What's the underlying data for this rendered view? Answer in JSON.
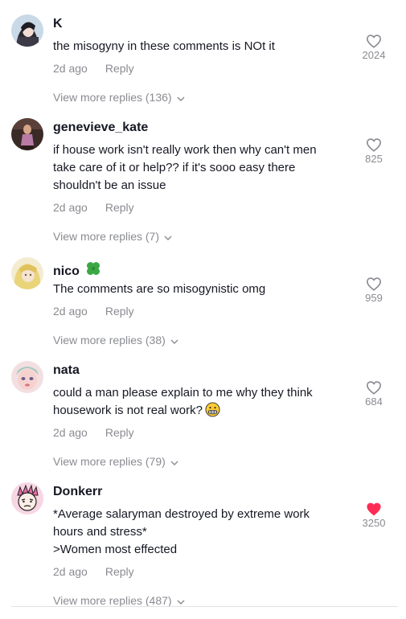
{
  "comments": [
    {
      "username": "K",
      "text": "the misogyny in these comments is NOt it",
      "time": "2d ago",
      "reply_label": "Reply",
      "likes": "2024",
      "liked": false,
      "view_replies": "View more replies (136)",
      "avatar_icon": "avatar-k"
    },
    {
      "username": "genevieve_kate",
      "text": "if house work isn't really work then why can't men\ntake care of it or help?? if it's sooo easy there\nshouldn't be an issue",
      "time": "2d ago",
      "reply_label": "Reply",
      "likes": "825",
      "liked": false,
      "view_replies": "View more replies (7)",
      "avatar_icon": "avatar-genevieve-kate"
    },
    {
      "username": "nico",
      "username_icon": "four-leaf-clover-icon",
      "text": "The comments are so misogynistic omg",
      "time": "2d ago",
      "reply_label": "Reply",
      "likes": "959",
      "liked": false,
      "view_replies": "View more replies (38)",
      "avatar_icon": "avatar-nico"
    },
    {
      "username": "nata",
      "text": "could a man please explain to me why they think\nhousework is not real work?",
      "text_emoji": "grimacing-face-emoji",
      "time": "2d ago",
      "reply_label": "Reply",
      "likes": "684",
      "liked": false,
      "view_replies": "View more replies (79)",
      "avatar_icon": "avatar-nata"
    },
    {
      "username": "Donkerr",
      "text": "*Average salaryman destroyed by extreme work\nhours and stress*\n>Women most effected",
      "time": "2d ago",
      "reply_label": "Reply",
      "likes": "3250",
      "liked": true,
      "view_replies": "View more replies (487)",
      "avatar_icon": "avatar-donkerr"
    }
  ],
  "colors": {
    "text": "#161823",
    "muted": "#8a8b91",
    "like_active": "#fe2c55",
    "divider": "#e3e3e4"
  }
}
